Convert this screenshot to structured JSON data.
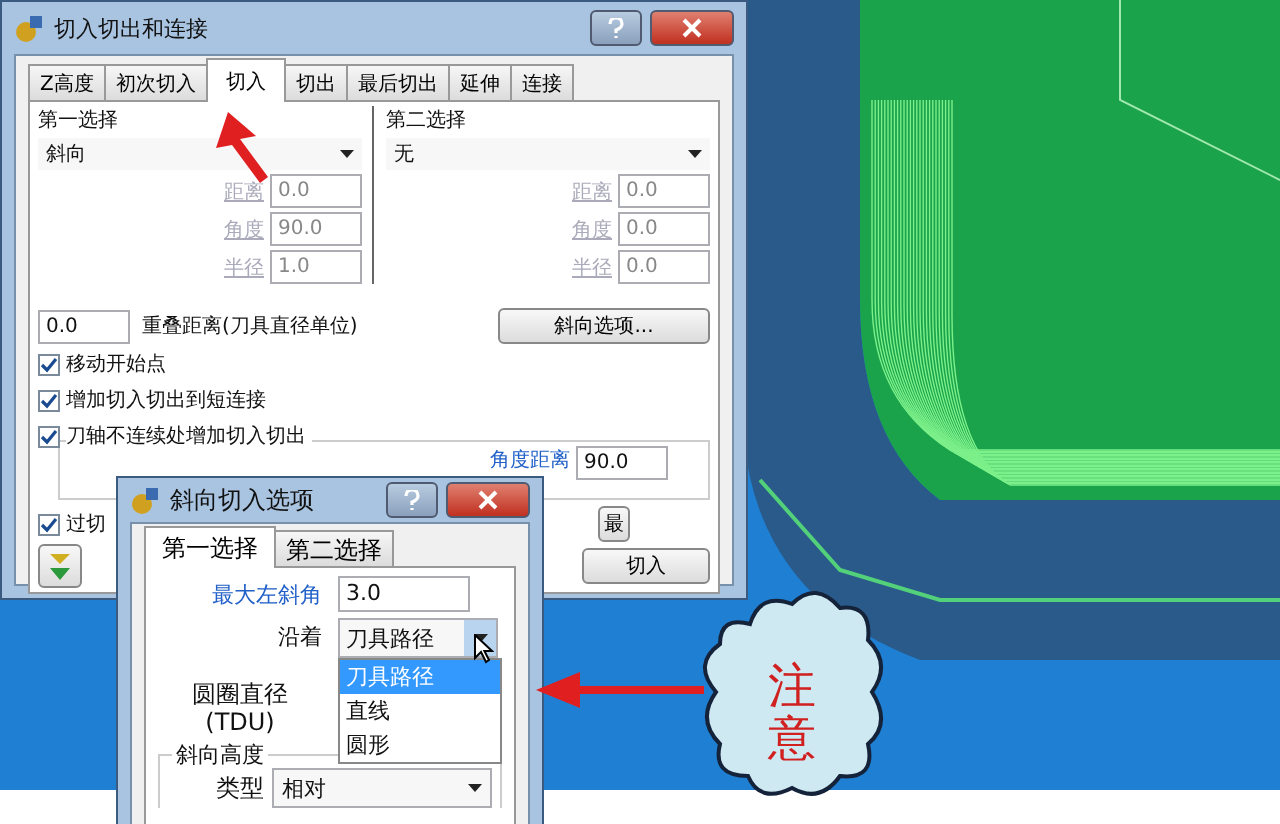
{
  "main_dialog": {
    "title": "切入切出和连接",
    "tabs": [
      {
        "label": "Z高度",
        "selected": false
      },
      {
        "label": "初次切入",
        "selected": false
      },
      {
        "label": "切入",
        "selected": true
      },
      {
        "label": "切出",
        "selected": false
      },
      {
        "label": "最后切出",
        "selected": false
      },
      {
        "label": "延伸",
        "selected": false
      },
      {
        "label": "连接",
        "selected": false
      }
    ],
    "first_choice": {
      "label": "第一选择",
      "value": "斜向",
      "fields": [
        {
          "label": "距离",
          "value": "0.0",
          "disabled": true
        },
        {
          "label": "角度",
          "value": "90.0",
          "disabled": true
        },
        {
          "label": "半径",
          "value": "1.0",
          "disabled": true
        }
      ]
    },
    "second_choice": {
      "label": "第二选择",
      "value": "无",
      "fields": [
        {
          "label": "距离",
          "value": "0.0",
          "disabled": true
        },
        {
          "label": "角度",
          "value": "0.0",
          "disabled": true
        },
        {
          "label": "半径",
          "value": "0.0",
          "disabled": true
        }
      ]
    },
    "overlap": {
      "value": "0.0",
      "label": "重叠距离(刀具直径单位)"
    },
    "ramp_options_button": "斜向选项...",
    "checkboxes": [
      {
        "label": "移动开始点",
        "checked": true
      },
      {
        "label": "增加切入切出到短连接",
        "checked": true
      },
      {
        "label": "刀轴不连续处增加切入切出",
        "checked": true
      }
    ],
    "angle_distance": {
      "label": "角度距离",
      "value": "90.0"
    },
    "gouge_check": {
      "label": "过切",
      "checked": true
    },
    "partial_button": "最",
    "apply_button": "切入"
  },
  "ramp_dialog": {
    "title": "斜向切入选项",
    "tabs": [
      {
        "label": "第一选择",
        "selected": true
      },
      {
        "label": "第二选择",
        "selected": false
      }
    ],
    "max_left_angle": {
      "label": "最大左斜角",
      "value": "3.0"
    },
    "along": {
      "label": "沿着",
      "value": "刀具路径",
      "options": [
        {
          "label": "刀具路径",
          "selected": true
        },
        {
          "label": "直线",
          "selected": false
        },
        {
          "label": "圆形",
          "selected": false
        }
      ]
    },
    "circle_diameter": {
      "label": "圆圈直径",
      "unit": "(TDU)"
    },
    "ramp_height": {
      "title": "斜向高度",
      "type_label": "类型",
      "type_value": "相对"
    }
  },
  "callout": {
    "text": "注意"
  }
}
